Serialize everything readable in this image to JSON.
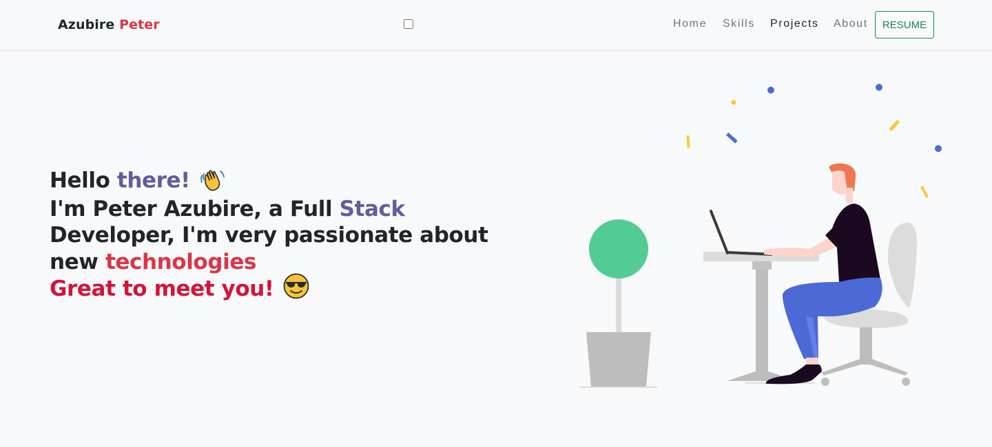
{
  "nav": {
    "brand_first": "Azubire",
    "brand_last": "Peter",
    "links": [
      {
        "label": "Home"
      },
      {
        "label": "Skills"
      },
      {
        "label": "Projects"
      },
      {
        "label": "About"
      }
    ],
    "active_link": "Projects",
    "resume_label": "RESUME"
  },
  "hero": {
    "hello": "Hello ",
    "there": "there!",
    "intro_1": "I'm Peter Azubire, a Full ",
    "stack": "Stack",
    "intro_2": " Developer, I'm very passionate about new ",
    "technologies": "technologies",
    "greet": "Great to meet you!",
    "wave_icon": "waving-hand-icon",
    "sunglasses_icon": "smiling-face-with-sunglasses-icon"
  },
  "colors": {
    "accent_red": "#dc3545",
    "accent_purple": "#635c9c",
    "resume_green": "#198754",
    "greet_red": "#d2143a"
  }
}
